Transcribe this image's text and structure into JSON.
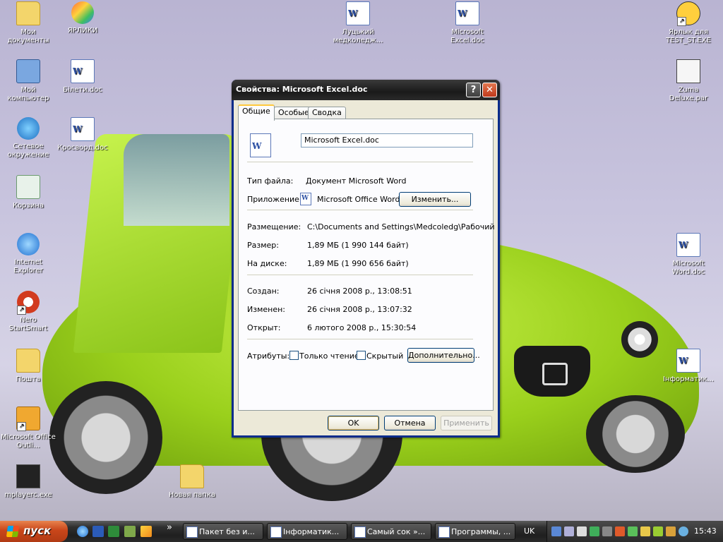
{
  "desktop": {
    "icons_left": [
      {
        "label": "Мои документы",
        "icon": "folder-icon"
      },
      {
        "label": "Мой компьютер",
        "icon": "computer-icon"
      },
      {
        "label": "Сетевое окружение",
        "icon": "network-icon"
      },
      {
        "label": "Корзина",
        "icon": "recycle-bin-icon"
      },
      {
        "label": "Internet Explorer",
        "icon": "ie-icon"
      },
      {
        "label": "Nero StartSmart",
        "icon": "nero-icon"
      },
      {
        "label": "Пошта",
        "icon": "folder-icon"
      },
      {
        "label": "Microsoft Office Outli...",
        "icon": "outlook-icon"
      },
      {
        "label": "mplayerc.exe",
        "icon": "clapperboard-icon"
      }
    ],
    "icons_col2": [
      {
        "label": "ЯРЛИКИ",
        "icon": "butterfly-icon"
      },
      {
        "label": "Білети.doc",
        "icon": "word-doc-icon"
      },
      {
        "label": "Кросворд.doc",
        "icon": "word-doc-icon"
      }
    ],
    "icon_lutsk": "Луцький медколедж...",
    "icon_excel_doc": "Microsoft Excel.doc",
    "icon_new_folder": "Новая папка",
    "icon_test": "Ярлык для TEST_ST.EXE",
    "icon_zuma": "Zuma Deluxe.par",
    "icon_word_doc": "Microsoft Word.doc",
    "icon_inform": "Інформатик..."
  },
  "dialog": {
    "title": "Свойства: Microsoft Excel.doc",
    "help": "?",
    "close": "✕",
    "tabs": [
      "Общие",
      "Особые",
      "Сводка"
    ],
    "filename": "Microsoft Excel.doc",
    "type_label": "Тип файла:",
    "type_value": "Документ Microsoft Word",
    "app_label": "Приложение:",
    "app_value": "Microsoft Office Word",
    "change_button": "Изменить...",
    "location_label": "Размещение:",
    "location_value": "C:\\Documents and Settings\\Medcoledg\\Рабочий",
    "size_label": "Размер:",
    "size_value": "1,89 МБ (1 990 144 байт)",
    "ondisk_label": "На диске:",
    "ondisk_value": "1,89 МБ (1 990 656 байт)",
    "created_label": "Создан:",
    "created_value": "26 січня 2008 р., 13:08:51",
    "modified_label": "Изменен:",
    "modified_value": "26 січня 2008 р., 13:07:32",
    "opened_label": "Открыт:",
    "opened_value": "6 лютого 2008 р., 15:30:54",
    "attributes_label": "Атрибуты:",
    "readonly_label": "Только чтение",
    "hidden_label": "Скрытый",
    "advanced_button": "Дополнительно...",
    "ok_button": "OK",
    "cancel_button": "Отмена",
    "apply_button": "Применить"
  },
  "taskbar": {
    "start_label": "пуск",
    "chevron": "»",
    "tasks": [
      "Пакет без и...",
      "Інформатик...",
      "Самый сок »...",
      "Программы, ..."
    ],
    "lang": "UK",
    "clock": "15:43"
  },
  "colors": {
    "taskbar": "#2b2b2b",
    "start": "#c9461a",
    "dialog_title": "#1a1a1a",
    "dialog_body": "#ece9d8",
    "car_green": "#9ad01c"
  }
}
